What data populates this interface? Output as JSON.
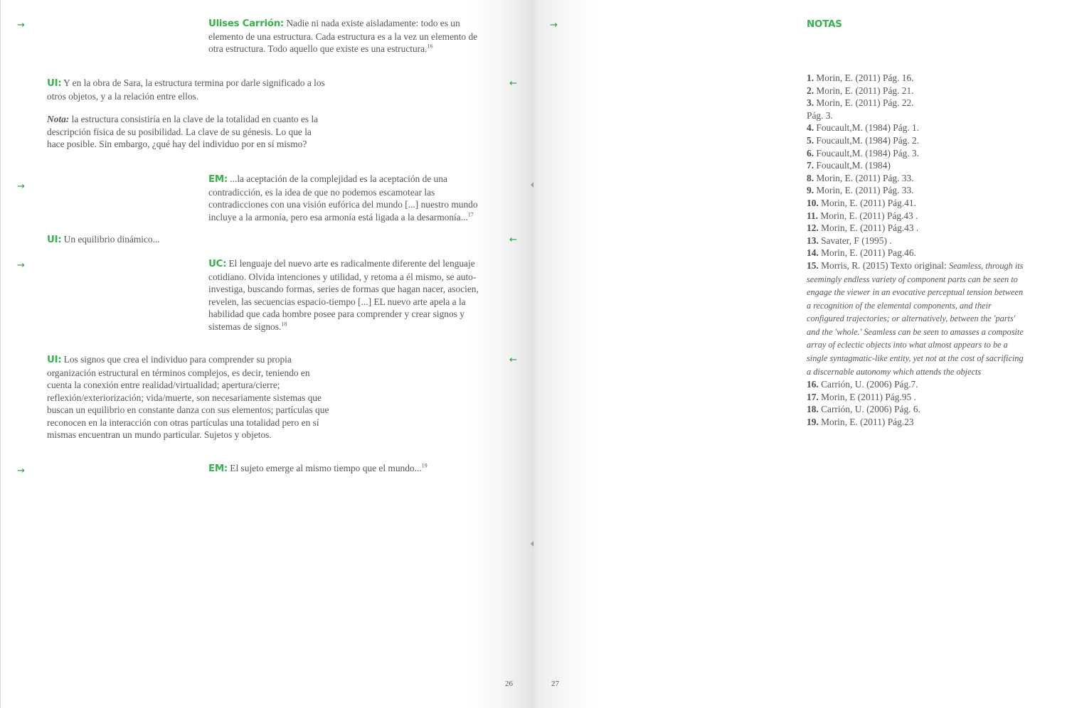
{
  "left_page": {
    "page_number": "26",
    "arrow_right": "→",
    "arrow_left": "←",
    "blocks": [
      {
        "speaker": "Ulises Carrión:",
        "text": " Nadie ni nada existe aisladamente: todo es un elemento de una estructura. Cada estructura es a la vez un elemento de otra estructura. Todo aquello que existe es una estructura.",
        "footnote": "16"
      },
      {
        "speaker": "UI:",
        "text": " Y en la obra de Sara, la estructura termina por darle significado a los otros objetos, y a la relación entre ellos."
      },
      {
        "label": "Nota:",
        "text": " la estructura consistiría en la clave de la totalidad en cuanto es la descripción física de su posibilidad. La clave de su génesis. Lo que la hace posible. Sin embargo, ¿qué hay del individuo por en sí mismo?"
      },
      {
        "speaker": "EM:",
        "text": " ...la aceptación de la complejidad es la aceptación de una contradicción, es la idea de que no podemos escamotear las contradicciones con una visión eufórica del mundo [...] nuestro mundo incluye a la armonía, pero esa armonía está ligada a la desarmonía...",
        "footnote": "17"
      },
      {
        "speaker": "UI:",
        "text": " Un equilibrio dinámico..."
      },
      {
        "speaker": "UC:",
        "text": " El lenguaje del nuevo arte es radicalmente diferente del lenguaje cotidiano. Olvida intenciones y utilidad, y retoma a él mismo, se auto-investiga, buscando formas, series de formas que hagan nacer, asocien, revelen, las secuencias espacio-tiempo [...] EL nuevo arte apela a la habilidad que cada hombre posee para comprender y crear signos y sistemas de signos.",
        "footnote": "18"
      },
      {
        "speaker": "UI:",
        "text": " Los signos que crea el individuo para comprender su propia organización estructural en términos complejos, es decir, teniendo en cuenta la conexión entre realidad/virtualidad; apertura/cierre; reflexión/exteriorización; vida/muerte, son necesariamente sistemas que buscan un equilibrio en constante danza con sus elementos; partículas que reconocen en la interacción con otras partículas una totalidad pero en sí mismas encuentran un mundo particular. Sujetos y objetos."
      },
      {
        "speaker": "EM:",
        "text": " El sujeto emerge al mismo tiempo que el mundo...",
        "footnote": "19"
      }
    ]
  },
  "right_page": {
    "page_number": "27",
    "arrow_right": "→",
    "title": "NOTAS",
    "notes": [
      {
        "num": "1.",
        "text": " Morin, E. (2011) Pág. 16."
      },
      {
        "num": "2.",
        "text": " Morin, E. (2011) Pág. 21."
      },
      {
        "num": "3.",
        "text": " Morin, E. (2011) Pág. 22."
      },
      {
        "num": "",
        "text": " Pág. 3."
      },
      {
        "num": "4.",
        "text": " Foucault,M. (1984) Pág. 1."
      },
      {
        "num": "5.",
        "text": " Foucault,M. (1984) Pág. 2."
      },
      {
        "num": "6.",
        "text": " Foucault,M. (1984) Pág. 3."
      },
      {
        "num": "7.",
        "text": " Foucault,M. (1984)"
      },
      {
        "num": "8.",
        "text": " Morin, E. (2011) Pág. 33."
      },
      {
        "num": "9.",
        "text": " Morin, E. (2011) Pág. 33."
      },
      {
        "num": "10.",
        "text": " Morin, E. (2011) Pág.41."
      },
      {
        "num": "11.",
        "text": " Morin, E. (2011) Pág.43  ."
      },
      {
        "num": "12.",
        "text": " Morin, E. (2011) Pág.43 ."
      },
      {
        "num": "13.",
        "text": " Savater, F (1995) ."
      },
      {
        "num": "14.",
        "text": " Morin, E. (2011) Pag.46."
      },
      {
        "num": "15.",
        "text": " Morris, R. (2015) Texto original: ",
        "original": "Seamless, through its seemingly endless variety of component parts can be seen to engage the viewer in an evocative perceptual tension between a recognition of the elemental components, and their configured trajectories; or alternatively, between the 'parts' and the 'whole.' Seamless can be seen to amasses a composite array of eclectic objects into what almost appears to be a single syntagmatic-like entity, yet not at the cost of sacrificing a discernable autonomy which attends the objects"
      },
      {
        "num": "16.",
        "text": " Carrión, U. (2006) Pág.7."
      },
      {
        "num": "17.",
        "text": " Morin, E (2011) Pág.95  ."
      },
      {
        "num": "18.",
        "text": " Carrión, U. (2006) Pág. 6."
      },
      {
        "num": "19.",
        "text": " Morin, E. (2011) Pág.23"
      }
    ]
  },
  "colors": {
    "accent_green": "#36b24a",
    "text_gray": "#555555",
    "arrow_green": "#2a9a3a"
  },
  "icons": {
    "arrow_right": "arrow-right-icon",
    "arrow_left": "arrow-left-icon",
    "gutter_marker": "triangle-left-icon"
  }
}
